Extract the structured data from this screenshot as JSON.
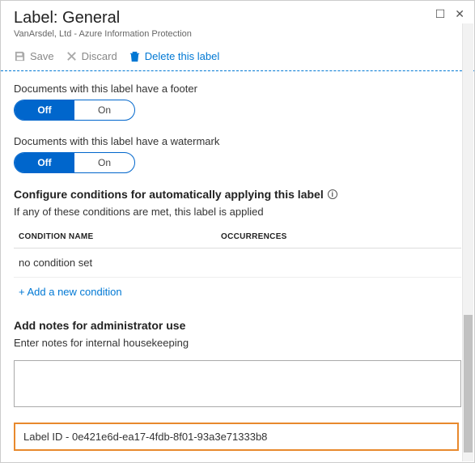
{
  "header": {
    "title": "Label: General",
    "subtitle": "VanArsdel, Ltd - Azure Information Protection"
  },
  "toolbar": {
    "save": "Save",
    "discard": "Discard",
    "delete": "Delete this label"
  },
  "footer_section": {
    "label": "Documents with this label have a footer",
    "off": "Off",
    "on": "On"
  },
  "watermark_section": {
    "label": "Documents with this label have a watermark",
    "off": "Off",
    "on": "On"
  },
  "conditions": {
    "heading": "Configure conditions for automatically applying this label",
    "helper": "If any of these conditions are met, this label is applied",
    "col1": "CONDITION NAME",
    "col2": "OCCURRENCES",
    "empty": "no condition set",
    "add": "+ Add a new condition"
  },
  "notes": {
    "heading": "Add notes for administrator use",
    "helper": "Enter notes for internal housekeeping"
  },
  "label_id": "Label ID - 0e421e6d-ea17-4fdb-8f01-93a3e71333b8"
}
